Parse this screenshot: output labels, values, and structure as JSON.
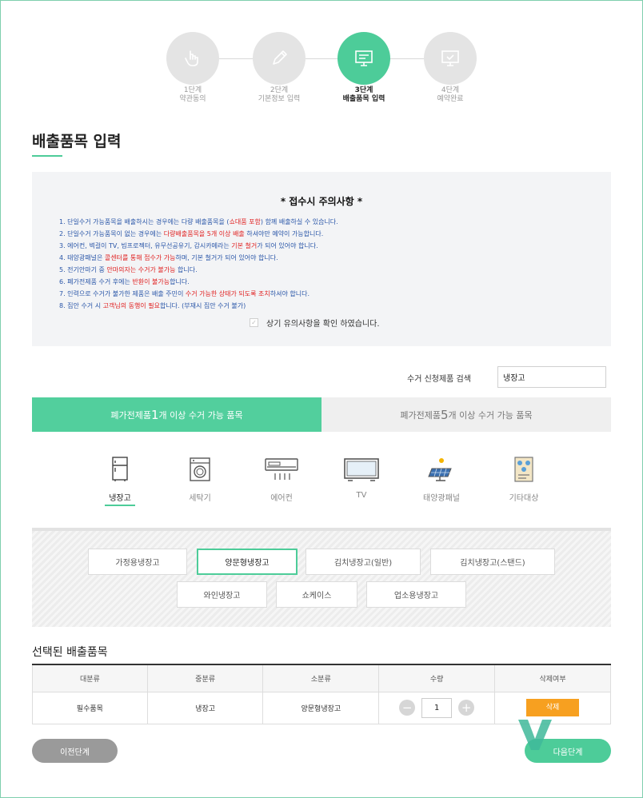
{
  "steps": [
    {
      "num": "1단계",
      "label": "약관동의",
      "icon": "hand-pointer-icon"
    },
    {
      "num": "2단계",
      "label": "기본정보 입력",
      "icon": "pencil-icon"
    },
    {
      "num": "3단계",
      "label": "배출품목 입력",
      "icon": "monitor-icon"
    },
    {
      "num": "4단계",
      "label": "예약완료",
      "icon": "monitor-check-icon"
    }
  ],
  "active_step": 2,
  "page_title": "배출품목 입력",
  "notice": {
    "title": "*  접수시 주의사항  *",
    "items": [
      {
        "a": "1. 단일수거 가능품목을 배출하시는 경우에는 다량 배출품목을 (",
        "r": "쇼대품 포함",
        "b": ") 함께 배출하실 수 있습니다."
      },
      {
        "a": "2. 단일수거 가능품목이 없는 경우에는 ",
        "r": "다량배출품목을 5개 이상 배출",
        "b": " 하셔야만 예약이 가능합니다."
      },
      {
        "a": "3. 에어컨, 벽걸이 TV, 빔프로젝터, 유무선공유기, 감시카메라는 ",
        "r": "기본 철거",
        "b": "가 되어 있어야 합니다."
      },
      {
        "a": "4. 태양광패널은 ",
        "r": "콜센터를 통해 접수가 가능",
        "b": "하며, 기본 철거가 되어 있어야 합니다."
      },
      {
        "a": "5. 전기안마기 중 ",
        "r": "안마의자는 수거가 불가능",
        "b": " 합니다."
      },
      {
        "a": "6. 폐가전제품 수거 후에는 ",
        "r": "반환이 불가능",
        "b": "합니다."
      },
      {
        "a": "7. 인력으로 수거가 불가한 제품은 배출 주민이 ",
        "r": "수거 가능한 상태가 되도록 조치",
        "b": "하셔야 합니다."
      },
      {
        "a": "8. 집안 수거 시 ",
        "r": "고객님의 동행이 필요",
        "b": "합니다. (부재시 집안 수거 불가)"
      }
    ],
    "confirm_label": "상기 유의사항을 확인 하였습니다.",
    "checkmark": "✓"
  },
  "search": {
    "label": "수거 신청제품 검색",
    "value": "냉장고"
  },
  "category_tabs": [
    {
      "pre": "폐가전제품 ",
      "big": "1",
      "post": "개 이상 수거 가능 품목",
      "active": true
    },
    {
      "pre": "폐가전제품 ",
      "big": "5",
      "post": "개 이상 수거 가능 품목",
      "active": false
    }
  ],
  "items": [
    {
      "name": "냉장고",
      "icon": "refrigerator-icon"
    },
    {
      "name": "세탁기",
      "icon": "washing-machine-icon"
    },
    {
      "name": "에어컨",
      "icon": "air-conditioner-icon"
    },
    {
      "name": "TV",
      "icon": "tv-icon"
    },
    {
      "name": "태양광패널",
      "icon": "solar-panel-icon"
    },
    {
      "name": "기타대상",
      "icon": "other-items-icon"
    }
  ],
  "active_item": 0,
  "subitems": [
    "가정용냉장고",
    "양문형냉장고",
    "김치냉장고(일반)",
    "김치냉장고(스탠드)",
    "와인냉장고",
    "쇼케이스",
    "업소용냉장고"
  ],
  "active_subitem": 1,
  "selected": {
    "title": "선택된 배출품목",
    "headers": [
      "대분류",
      "중분류",
      "소분류",
      "수량",
      "삭제여부"
    ],
    "rows": [
      {
        "major": "필수품목",
        "mid": "냉장고",
        "minor": "양문형냉장고",
        "qty": "1",
        "delete_label": "삭제"
      }
    ],
    "minus": "−",
    "plus": "+"
  },
  "buttons": {
    "prev": "이전단계",
    "next": "다음단계"
  },
  "colors": {
    "accent": "#4dcc99",
    "delete": "#f7a020",
    "notice_text": "#2a56a8",
    "notice_red": "#e02020"
  }
}
